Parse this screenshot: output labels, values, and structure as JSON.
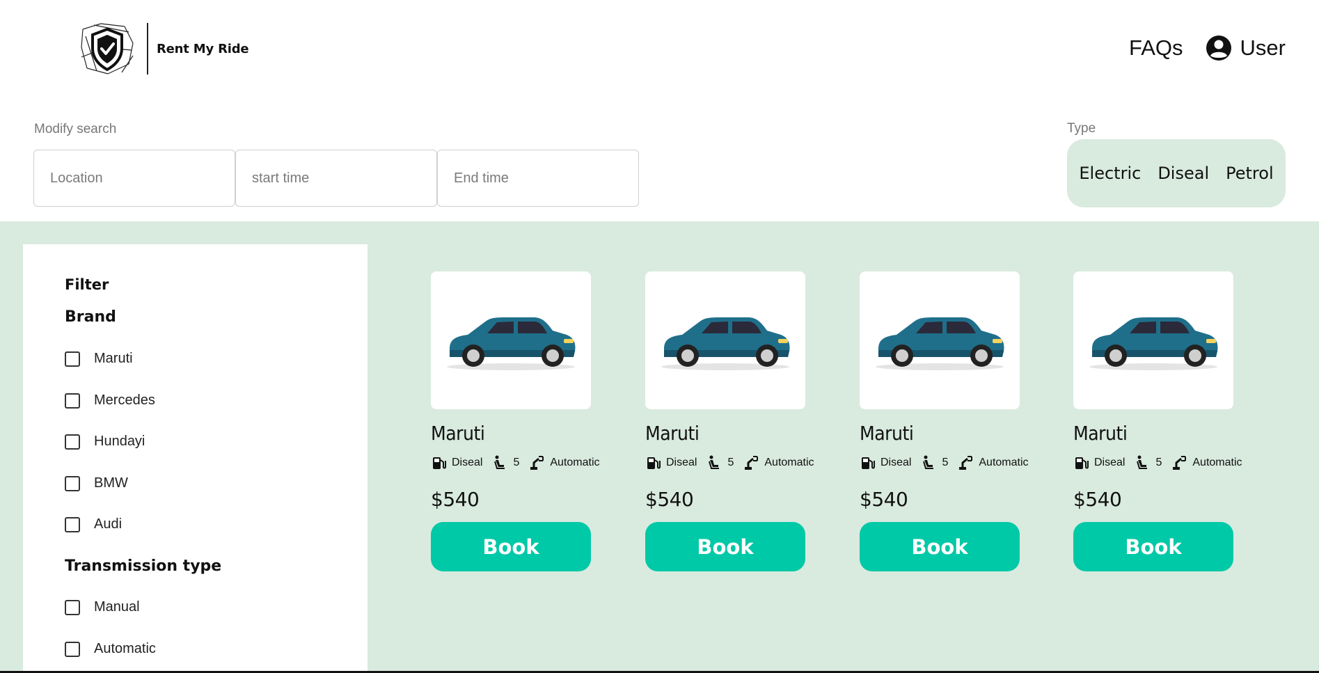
{
  "header": {
    "brand_name": "Rent My Ride",
    "nav_faq": "FAQs",
    "nav_user": "User"
  },
  "search": {
    "label": "Modify search",
    "location_placeholder": "Location",
    "start_placeholder": "start time",
    "end_placeholder": "End time"
  },
  "type": {
    "label": "Type",
    "options": [
      "Electric",
      "Diseal",
      "Petrol"
    ]
  },
  "filter": {
    "title": "Filter",
    "brand_title": "Brand",
    "brands": [
      "Maruti",
      "Mercedes",
      "Hundayi",
      "BMW",
      "Audi"
    ],
    "transmission_title": "Transmission type",
    "transmissions": [
      "Manual",
      "Automatic"
    ]
  },
  "cars": [
    {
      "name": "Maruti",
      "fuel": "Diseal",
      "seats": "5",
      "transmission": "Automatic",
      "price": "$540",
      "button": "Book"
    },
    {
      "name": "Maruti",
      "fuel": "Diseal",
      "seats": "5",
      "transmission": "Automatic",
      "price": "$540",
      "button": "Book"
    },
    {
      "name": "Maruti",
      "fuel": "Diseal",
      "seats": "5",
      "transmission": "Automatic",
      "price": "$540",
      "button": "Book"
    },
    {
      "name": "Maruti",
      "fuel": "Diseal",
      "seats": "5",
      "transmission": "Automatic",
      "price": "$540",
      "button": "Book"
    }
  ],
  "colors": {
    "accent": "#00c9a7",
    "panel_bg": "#d9eadf",
    "car_body": "#1f6f8b"
  },
  "icons": {
    "logo": "shield-check-icon",
    "user": "user-circle-icon",
    "fuel": "fuel-pump-icon",
    "seat": "seat-icon",
    "transmission": "robot-arm-icon"
  }
}
